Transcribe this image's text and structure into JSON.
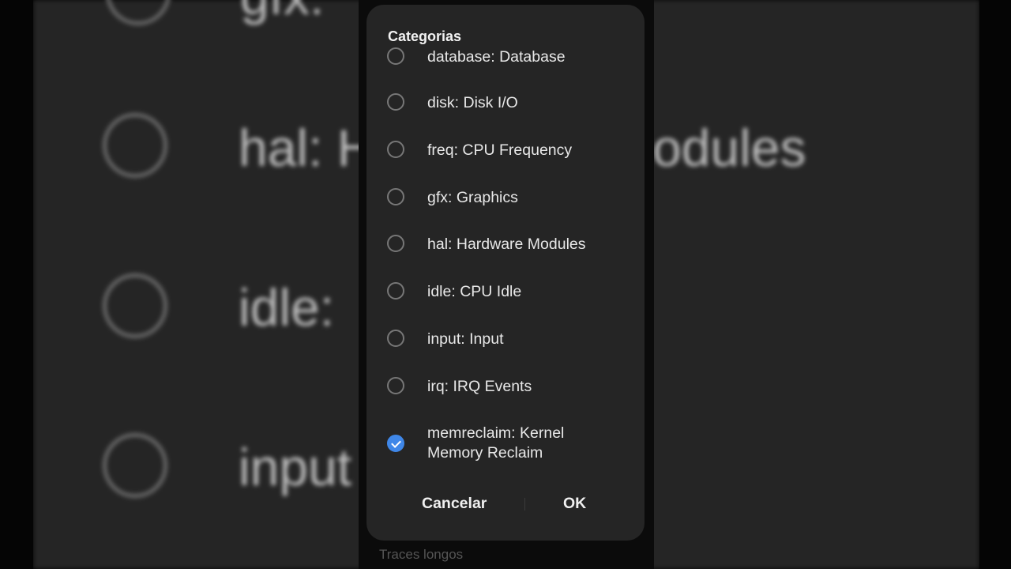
{
  "background": {
    "blurred_labels": [
      "gfx:",
      "hal: H",
      "odules",
      "idle:",
      "input"
    ],
    "footer_text": "Traces longos"
  },
  "dialog": {
    "title": "Categorias",
    "items": [
      {
        "label": "database: Database",
        "checked": false
      },
      {
        "label": "disk: Disk I/O",
        "checked": false
      },
      {
        "label": "freq: CPU Frequency",
        "checked": false
      },
      {
        "label": "gfx: Graphics",
        "checked": false
      },
      {
        "label": "hal: Hardware Modules",
        "checked": false
      },
      {
        "label": "idle: CPU Idle",
        "checked": false
      },
      {
        "label": "input: Input",
        "checked": false
      },
      {
        "label": "irq: IRQ Events",
        "checked": false
      },
      {
        "label": "memreclaim: Kernel Memory Reclaim",
        "checked": true
      }
    ],
    "cancel_label": "Cancelar",
    "ok_label": "OK"
  },
  "colors": {
    "dialog_bg": "#252525",
    "accent": "#3f87e8",
    "text": "#e8e8e8"
  },
  "icons": {
    "unchecked": "radio-unchecked-icon",
    "checked": "checkbox-checked-icon"
  }
}
